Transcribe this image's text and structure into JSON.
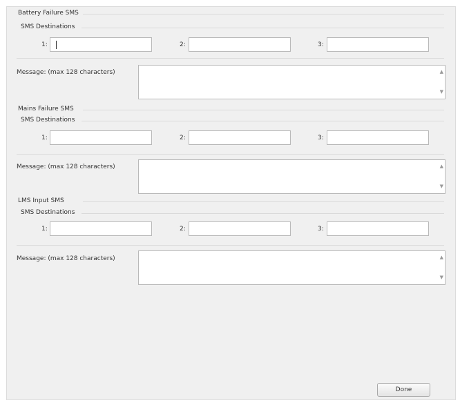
{
  "sections": [
    {
      "title": "Battery Failure SMS",
      "destinations_label": "SMS Destinations",
      "slots": [
        {
          "label": "1:",
          "value": ""
        },
        {
          "label": "2:",
          "value": ""
        },
        {
          "label": "3:",
          "value": ""
        }
      ],
      "message_label": "Message: (max 128 characters)",
      "message_value": ""
    },
    {
      "title": "Mains Failure SMS",
      "destinations_label": "SMS Destinations",
      "slots": [
        {
          "label": "1:",
          "value": ""
        },
        {
          "label": "2:",
          "value": ""
        },
        {
          "label": "3:",
          "value": ""
        }
      ],
      "message_label": "Message: (max 128 characters)",
      "message_value": ""
    },
    {
      "title": "LMS Input SMS",
      "destinations_label": "SMS Destinations",
      "slots": [
        {
          "label": "1:",
          "value": ""
        },
        {
          "label": "2:",
          "value": ""
        },
        {
          "label": "3:",
          "value": ""
        }
      ],
      "message_label": "Message: (max 128 characters)",
      "message_value": ""
    }
  ],
  "icons": {
    "scroll_up": "▲",
    "scroll_down": "▼"
  },
  "done_label": "Done"
}
